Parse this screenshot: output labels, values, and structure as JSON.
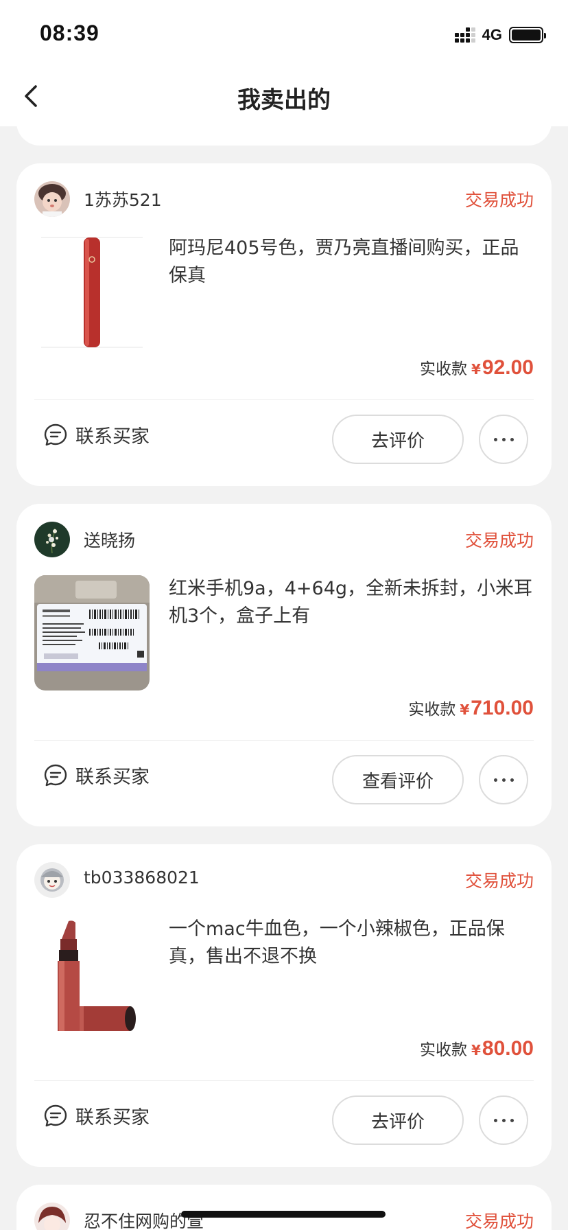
{
  "status_bar": {
    "time": "08:39",
    "network": "4G",
    "icons": [
      "signal-icon",
      "battery-icon"
    ]
  },
  "nav": {
    "title": "我卖出的",
    "back_icon": "chevron-left-icon"
  },
  "orders": [
    {
      "seller": "1苏苏521",
      "status": "交易成功",
      "description": "阿玛尼405号色，贾乃亮直播间购买，正品保真",
      "price_label": "实收款",
      "currency": "¥",
      "price": "92.00",
      "contact_label": "联系买家",
      "action_label": "去评价"
    },
    {
      "seller": "送晓扬",
      "status": "交易成功",
      "description": "红米手机9a，4+64g，全新未拆封，小米耳机3个，盒子上有",
      "price_label": "实收款",
      "currency": "¥",
      "price": "710.00",
      "contact_label": "联系买家",
      "action_label": "查看评价"
    },
    {
      "seller": "tb033868021",
      "status": "交易成功",
      "description": "一个mac牛血色，一个小辣椒色，正品保真，售出不退不换",
      "price_label": "实收款",
      "currency": "¥",
      "price": "80.00",
      "contact_label": "联系买家",
      "action_label": "去评价"
    },
    {
      "seller": "忍不住网购的萱",
      "status": "交易成功"
    }
  ],
  "colors": {
    "accent": "#e0513b",
    "background": "#f2f2f2",
    "card": "#ffffff"
  }
}
